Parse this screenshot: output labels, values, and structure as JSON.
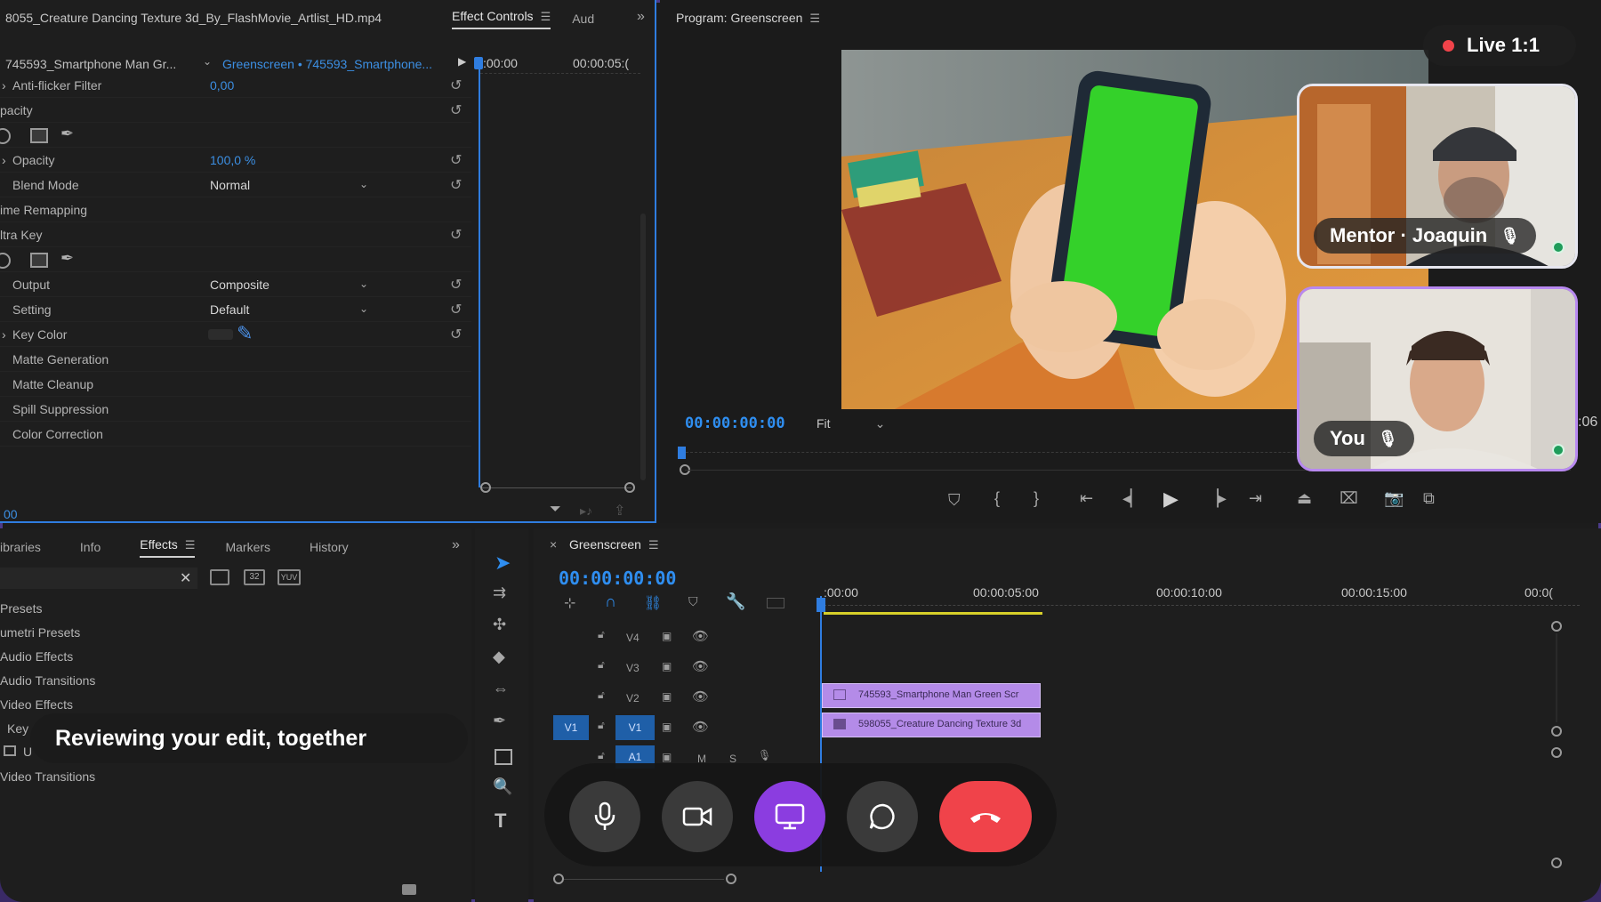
{
  "effect_controls": {
    "source_clip": "8055_Creature Dancing Texture 3d_By_FlashMovie_Artlist_HD.mp4",
    "tabs": [
      {
        "label": "Effect Controls",
        "active": true
      },
      {
        "label": "Aud",
        "active": false
      }
    ],
    "master_clip": "745593_Smartphone Man Gr...",
    "sequence_clip": "Greenscreen • 745593_Smartphone...",
    "time_start": ":00:00",
    "time_end": "00:00:05:(",
    "rows": [
      {
        "label": "Anti-flicker Filter",
        "value": "0,00"
      },
      {
        "label": "pacity"
      },
      {
        "label": "Opacity",
        "value": "100,0 %"
      },
      {
        "label": "Blend Mode",
        "dropdown": "Normal"
      },
      {
        "label": "ime Remapping"
      },
      {
        "label": "ltra Key"
      },
      {
        "label": "Output",
        "dropdown": "Composite"
      },
      {
        "label": "Setting",
        "dropdown": "Default"
      },
      {
        "label": "Key Color"
      },
      {
        "label": "Matte Generation"
      },
      {
        "label": "Matte Cleanup"
      },
      {
        "label": "Spill Suppression"
      },
      {
        "label": "Color Correction"
      }
    ],
    "bottom_time": "00"
  },
  "program_monitor": {
    "title": "Program: Greenscreen",
    "timecode": "00:00:00:00",
    "zoom": "Fit",
    "end_fragment": ":06"
  },
  "call": {
    "live_badge": "Live 1:1",
    "mentor_label": "Mentor · Joaquin",
    "self_label": "You",
    "caption": "Reviewing your edit, together",
    "accent_color": "#8b3de0",
    "end_call_color": "#f0434a"
  },
  "effects_panel": {
    "tabs": [
      {
        "label": "ibraries",
        "active": false
      },
      {
        "label": "Info",
        "active": false
      },
      {
        "label": "Effects",
        "active": true
      },
      {
        "label": "Markers",
        "active": false
      },
      {
        "label": "History",
        "active": false
      }
    ],
    "items": [
      "Presets",
      "umetri Presets",
      "Audio Effects",
      "Audio Transitions",
      "Video Effects",
      "Key",
      "U",
      "Video Transitions"
    ],
    "search_clear": "✕",
    "icon_labels": [
      "32",
      "YUV"
    ]
  },
  "timeline": {
    "sequence_name": "Greenscreen",
    "timecode": "00:00:00:00",
    "ruler": [
      ":00:00",
      "00:00:05:00",
      "00:00:10:00",
      "00:00:15:00",
      "00:0("
    ],
    "tracks": [
      "V4",
      "V3",
      "V2",
      "V1",
      "A1"
    ],
    "source_patch": "V1",
    "audio_toggles": [
      "M",
      "S"
    ],
    "clips": [
      {
        "label": "745593_Smartphone Man Green Scr"
      },
      {
        "label": "598055_Creature Dancing Texture 3d"
      }
    ]
  }
}
